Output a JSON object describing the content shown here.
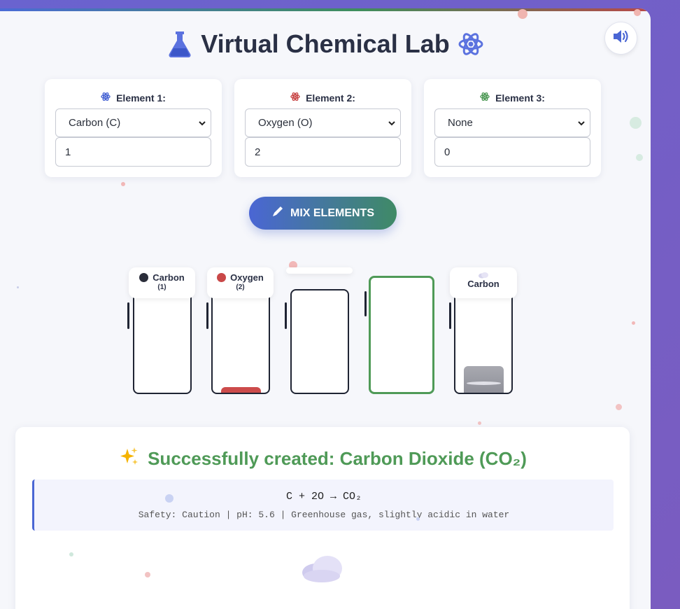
{
  "app": {
    "title": "Virtual Chemical Lab",
    "title_icon_left": "flask-icon",
    "title_icon_right": "atom-icon",
    "sound_button_icon": "volume-icon"
  },
  "elements": [
    {
      "label": "Element 1:",
      "icon": "atom-icon",
      "color": "#4a66d4",
      "selected": "Carbon (C)",
      "quantity": "1"
    },
    {
      "label": "Element 2:",
      "icon": "atom-icon",
      "color": "#c94848",
      "selected": "Oxygen (O)",
      "quantity": "2"
    },
    {
      "label": "Element 3:",
      "icon": "atom-icon",
      "color": "#4f9a57",
      "selected": "None",
      "quantity": "0"
    }
  ],
  "mix_button": {
    "label": "MIX ELEMENTS",
    "icon": "pencil-icon"
  },
  "beakers": [
    {
      "name": "Carbon",
      "count": "(1)",
      "color": "#2a2d3a"
    },
    {
      "name": "Oxygen",
      "count": "(2)",
      "color": "#c94848"
    },
    {
      "name": "",
      "count": ""
    },
    {
      "name": "",
      "count": ""
    },
    {
      "name": "Carbon",
      "count": "",
      "icon": "cloud-icon"
    }
  ],
  "result": {
    "icon": "sparkles-icon",
    "title": "Successfully created: Carbon Dioxide (CO₂)",
    "equation": "C + 2O → CO₂",
    "safety": "Safety: Caution | pH: 5.6 | Greenhouse gas, slightly acidic in water",
    "product_icon": "cloud-icon"
  },
  "colors": {
    "accent": "#4a66d4",
    "success": "#4f9a57",
    "danger": "#c94848"
  }
}
